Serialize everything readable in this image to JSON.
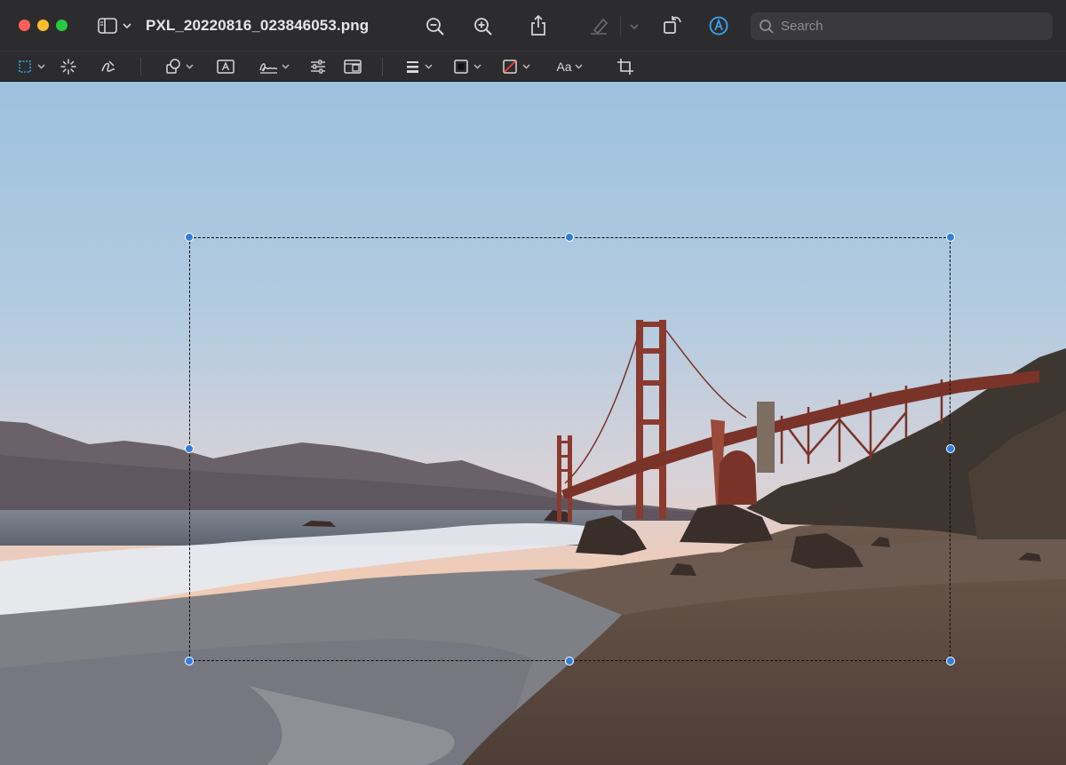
{
  "window": {
    "title": "PXL_20220816_023846053.png"
  },
  "search": {
    "placeholder": "Search"
  },
  "markup_toolbar": {
    "text_style_label": "Aa"
  },
  "colors": {
    "selection_handle": "#2f7fe0",
    "markup_accent": "#3aa6f5",
    "titlebar_bg": "#2c2c2e"
  },
  "icons": {
    "titlebar": [
      "sidebar-icon",
      "zoom-out-icon",
      "zoom-in-icon",
      "share-icon",
      "highlight-pen-icon",
      "rotate-icon",
      "markup-icon",
      "search-icon"
    ],
    "markup_tools": [
      "rectangular-selection-icon",
      "instant-alpha-icon",
      "sketch-icon",
      "shapes-icon",
      "text-box-icon",
      "signature-icon",
      "adjust-color-icon",
      "adjust-size-icon",
      "shape-style-icon",
      "border-color-icon",
      "fill-color-icon",
      "text-style-icon",
      "crop-icon"
    ]
  }
}
